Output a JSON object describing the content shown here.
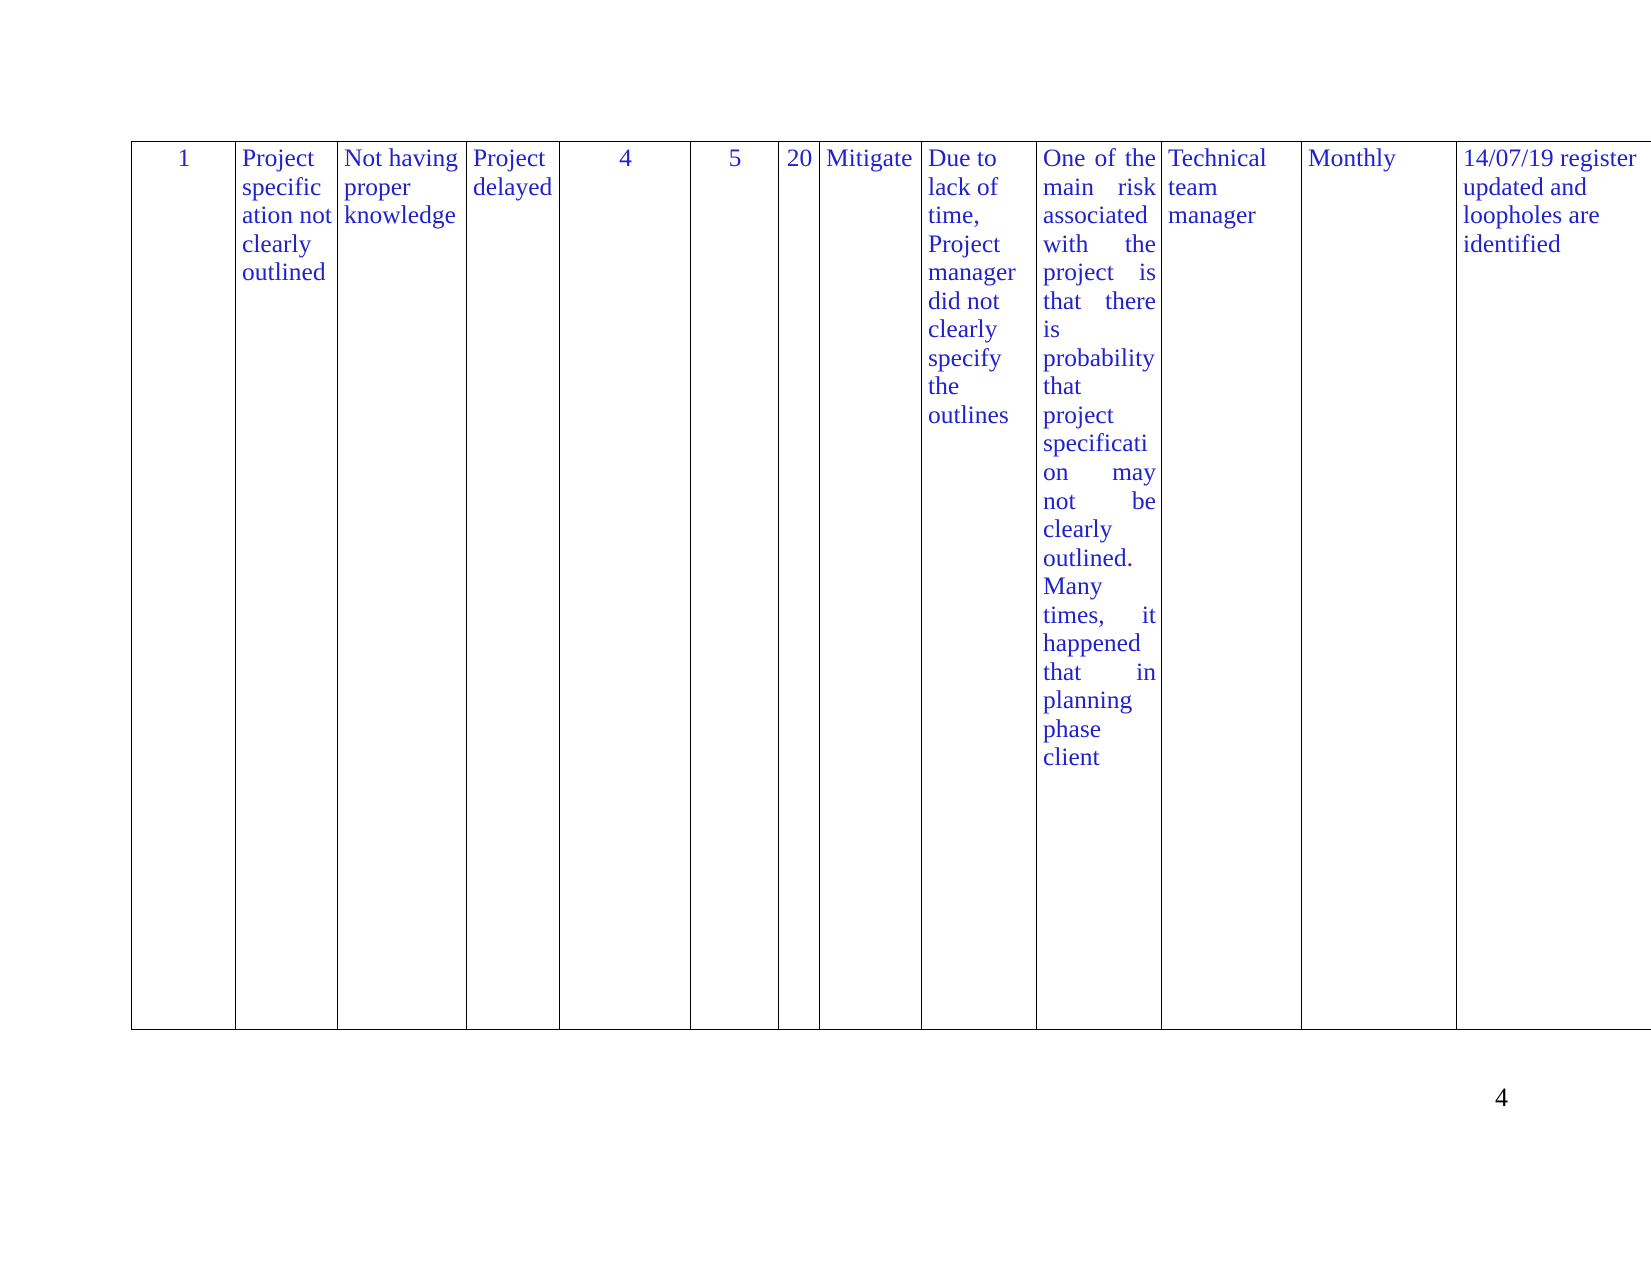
{
  "document": {
    "page_number": "4",
    "text_color": "#2222cc",
    "page_number_color": "#000000",
    "border_color": "#000000",
    "background": "#ffffff"
  },
  "table": {
    "name": "risk-register-table",
    "column_count": 13,
    "rows": [
      {
        "id": "1",
        "risk_description": "Project specification not clearly outlined",
        "cause": "Not having proper knowledge",
        "impact": "Project delayed",
        "likelihood": "4",
        "severity": "5",
        "score": "20",
        "response": "Mitigate",
        "reason": "Due to lack of time, Project manager did not clearly specify the outlines",
        "analysis": "One of the main risk associated with the project is that there is probability that project specification may not be clearly outlined. Many times, it happened that in planning phase client",
        "owner": "Technical team manager",
        "review_frequency": "Monthly",
        "status_update": "14/07/19 register updated and loopholes are identified"
      }
    ]
  }
}
